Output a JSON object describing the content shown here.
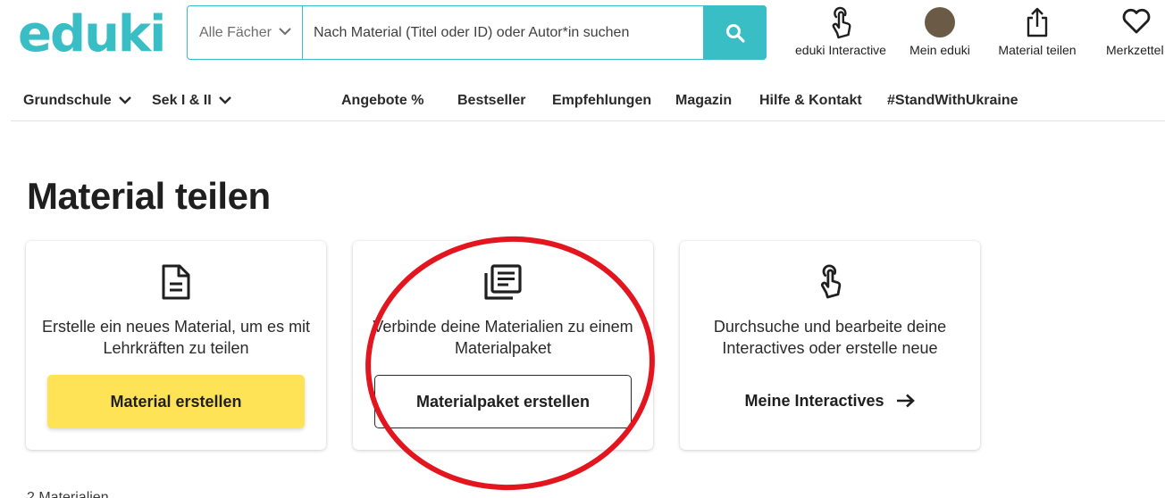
{
  "logo": {
    "text": "eduki"
  },
  "search": {
    "subject_label": "Alle Fächer",
    "placeholder": "Nach Material (Titel oder ID) oder Autor*in suchen",
    "button_icon": "search-icon"
  },
  "header_icons": [
    {
      "label": "eduki Interactive",
      "icon": "touch-hand-icon"
    },
    {
      "label": "Mein eduki",
      "icon": "avatar"
    },
    {
      "label": "Material teilen",
      "icon": "share-upload-icon"
    },
    {
      "label": "Merkzettel",
      "icon": "heart-icon"
    }
  ],
  "nav": {
    "grundschule": "Grundschule",
    "sek": "Sek I & II",
    "angebote": "Angebote %",
    "bestseller": "Bestseller",
    "empfehlungen": "Empfehlungen",
    "magazin": "Magazin",
    "hilfe": "Hilfe & Kontakt",
    "ukraine": "#StandWithUkraine"
  },
  "page": {
    "title": "Material teilen"
  },
  "cards": [
    {
      "icon": "document-icon",
      "description": "Erstelle ein neues Material, um es mit Lehrkräften zu teilen",
      "cta": "Material erstellen"
    },
    {
      "icon": "stacked-documents-icon",
      "description": "Verbinde deine Materialien zu einem Materialpaket",
      "cta": "Materialpaket erstellen"
    },
    {
      "icon": "touch-hand-icon",
      "description": "Durchsuche und bearbeite deine Interactives oder erstelle neue",
      "cta": "Meine Interactives"
    }
  ],
  "colors": {
    "brand": "#38bec4",
    "primary_button": "#fde355",
    "annotation": "#e3161f",
    "avatar": "#6b5a45"
  },
  "footer_partial": {
    "text": "2 Materialien"
  }
}
